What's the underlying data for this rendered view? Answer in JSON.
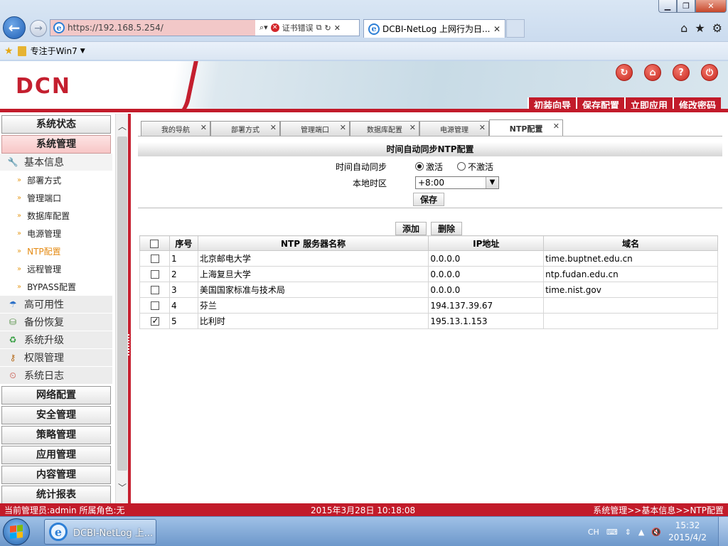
{
  "browser": {
    "url": "https://192.168.5.254/",
    "cert_error": "证书错误",
    "tab_title": "DCBI-NetLog 上网行为日...",
    "favorites_item": "专注于Win7"
  },
  "header": {
    "logo": "DCN",
    "actions": [
      "初装向导",
      "保存配置",
      "立即应用",
      "修改密码"
    ]
  },
  "sidebar": {
    "top_categories": [
      "系统状态",
      "系统管理"
    ],
    "sub_basic": "基本信息",
    "leaves": [
      "部署方式",
      "管理端口",
      "数据库配置",
      "电源管理",
      "NTP配置",
      "远程管理",
      "BYPASS配置"
    ],
    "subs": [
      "高可用性",
      "备份恢复",
      "系统升级",
      "权限管理",
      "系统日志"
    ],
    "bottom_categories": [
      "网络配置",
      "安全管理",
      "策略管理",
      "应用管理",
      "内容管理",
      "统计报表"
    ]
  },
  "tabs": [
    "我的导航",
    "部署方式",
    "管理端口",
    "数据库配置",
    "电源管理",
    "NTP配置"
  ],
  "ntp": {
    "title": "时间自动同步NTP配置",
    "sync_label": "时间自动同步",
    "opt_on": "激活",
    "opt_off": "不激活",
    "tz_label": "本地时区",
    "tz_value": "+8:00",
    "save": "保存"
  },
  "grid": {
    "add": "添加",
    "delete": "删除",
    "columns": [
      "",
      "序号",
      "NTP 服务器名称",
      "IP地址",
      "域名"
    ],
    "rows": [
      {
        "checked": false,
        "no": "1",
        "name": "北京邮电大学",
        "ip": "0.0.0.0",
        "domain": "time.buptnet.edu.cn"
      },
      {
        "checked": false,
        "no": "2",
        "name": "上海复旦大学",
        "ip": "0.0.0.0",
        "domain": "ntp.fudan.edu.cn"
      },
      {
        "checked": false,
        "no": "3",
        "name": "美国国家标准与技术局",
        "ip": "0.0.0.0",
        "domain": "time.nist.gov"
      },
      {
        "checked": false,
        "no": "4",
        "name": "芬兰",
        "ip": "194.137.39.67",
        "domain": ""
      },
      {
        "checked": true,
        "no": "5",
        "name": "比利时",
        "ip": "195.13.1.153",
        "domain": ""
      }
    ]
  },
  "status": {
    "left": "当前管理员:admin  所属角色:无",
    "datetime": "2015年3月28日 10:18:08",
    "breadcrumb": "系统管理>>基本信息>>NTP配置"
  },
  "taskbar": {
    "item": "DCBI-NetLog 上...",
    "lang": "CH",
    "time": "15:32",
    "date": "2015/4/2"
  }
}
